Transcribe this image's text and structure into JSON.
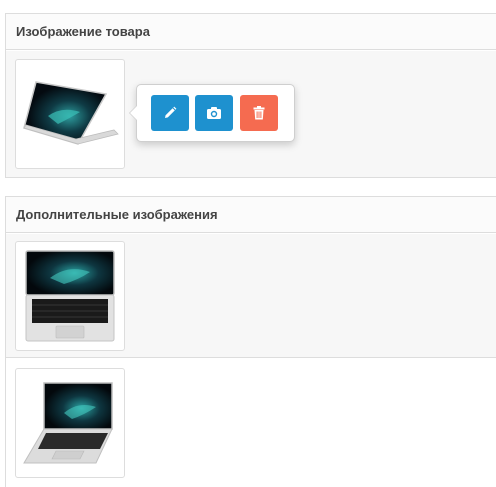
{
  "main_image_panel": {
    "title": "Изображение товара"
  },
  "additional_images_panel": {
    "title": "Дополнительные изображения"
  },
  "image_actions": {
    "edit_icon": "pencil-icon",
    "upload_icon": "camera-icon",
    "delete_icon": "trash-icon"
  },
  "colors": {
    "primary": "#1e91cf",
    "danger": "#f56b50",
    "border": "#dddddd",
    "panel_heading_bg": "#fbfbfb",
    "row_alt_bg": "#f7f7f7"
  }
}
